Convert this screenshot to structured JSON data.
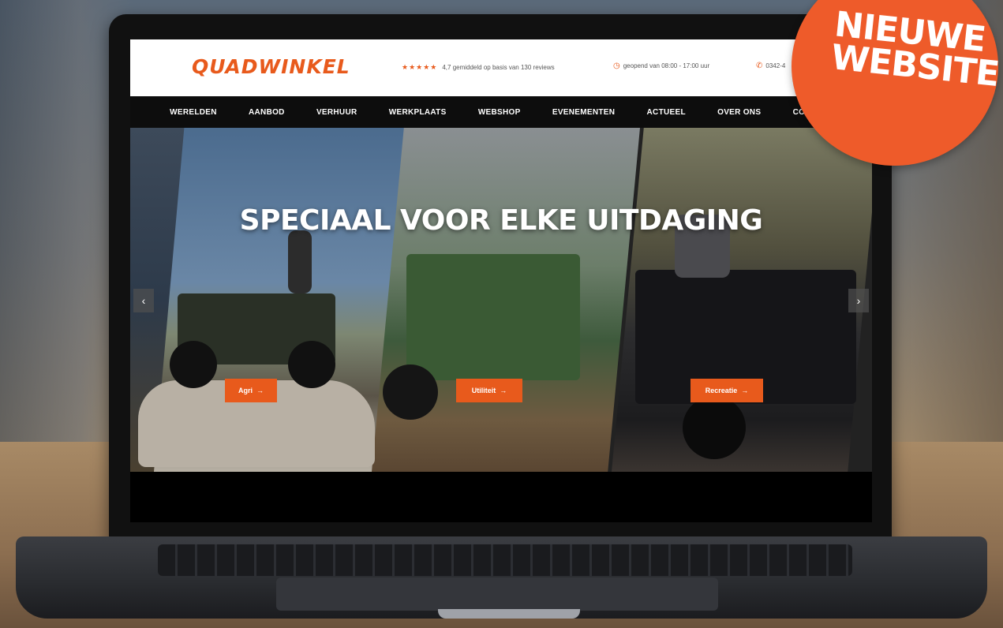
{
  "site": {
    "logo": "QUADWINKEL",
    "rating_stars": "★★★★★",
    "rating_text": "4,7 gemiddeld op basis van 130 reviews",
    "hours": "geopend van 08:00 - 17:00 uur",
    "phone": "0342-4"
  },
  "nav": {
    "items": [
      "WERELDEN",
      "AANBOD",
      "VERHUUR",
      "WERKPLAATS",
      "WEBSHOP",
      "EVENEMENTEN",
      "ACTUEEL",
      "OVER ONS",
      "CONTACT"
    ]
  },
  "hero": {
    "title": "SPECIAAL VOOR ELKE UITDAGING",
    "buttons": [
      "Agri",
      "Utiliteit",
      "Recreatie"
    ],
    "arrow_icon": "→",
    "prev_icon": "‹",
    "next_icon": "›"
  },
  "badge": {
    "line1": "NIEUWE",
    "line2": "WEBSITE"
  },
  "icons": {
    "clock": "clock-icon",
    "phone": "phone-icon",
    "star": "star-icon"
  },
  "colors": {
    "brand": "#e85a1c",
    "nav_bg": "#0d0d0d",
    "badge": "#ee5b2a"
  }
}
